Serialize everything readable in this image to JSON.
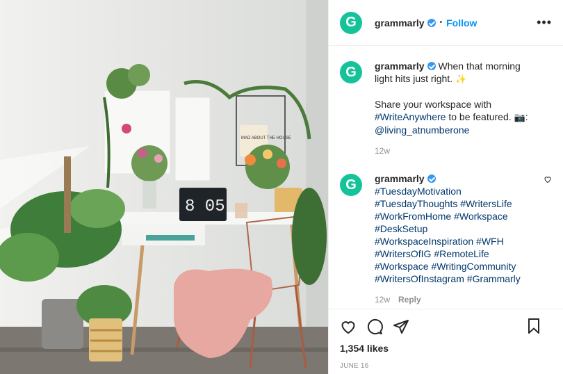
{
  "header": {
    "avatar_letter": "G",
    "username": "grammarly",
    "dot": "•",
    "follow_label": "Follow",
    "more_label": "•••"
  },
  "caption": {
    "username": "grammarly",
    "text_1": "When that morning light hits just right.",
    "sparkle_emoji": "✨",
    "text_2": "Share your workspace with",
    "hashtag_1": "#WriteAnywhere",
    "text_3": "to be featured.",
    "camera_emoji": "📷",
    "colon": ":",
    "mention": "@living_atnumberone",
    "time": "12w"
  },
  "comment": {
    "username": "grammarly",
    "tags": [
      "#TuesdayMotivation",
      "#TuesdayThoughts",
      "#WritersLife",
      "#WorkFromHome",
      "#Workspace",
      "#DeskSetup",
      "#WorkspaceInspiration",
      "#WFH",
      "#WritersOfIG",
      "#RemoteLife",
      "#Workspace",
      "#WritingCommunity",
      "#WritersOfInstagram",
      "#Grammarly"
    ],
    "time": "12w",
    "reply_label": "Reply"
  },
  "actions": {
    "likes": "1,354 likes",
    "date": "JUNE 16"
  },
  "photo": {
    "clock_time": "8 05",
    "poster_text": "MAD ABOUT THE HOUSE"
  },
  "colors": {
    "brand": "#15c39a",
    "link": "#0095f6",
    "hashtag": "#00376b",
    "verified": "#3897f0"
  }
}
